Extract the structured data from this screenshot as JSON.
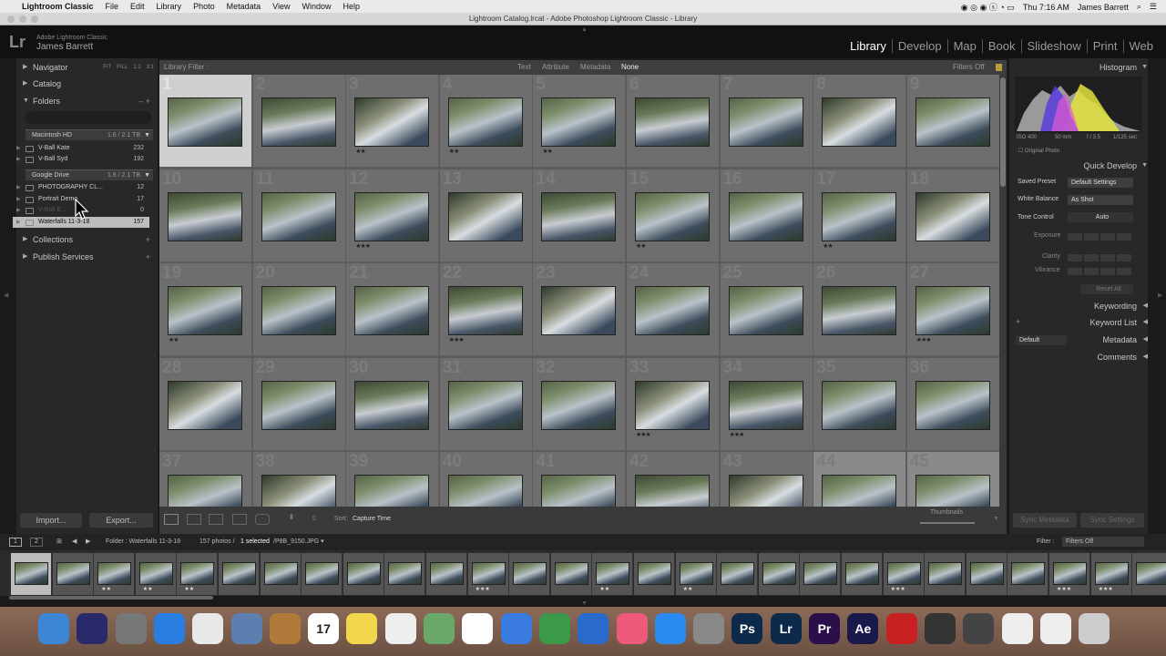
{
  "menubar": {
    "app": "Lightroom Classic",
    "items": [
      "File",
      "Edit",
      "Library",
      "Photo",
      "Metadata",
      "View",
      "Window",
      "Help"
    ],
    "clock": "Thu 7:16 AM",
    "user": "James Barrett"
  },
  "window": {
    "title": "Lightroom Catalog.lrcat - Adobe Photoshop Lightroom Classic - Library"
  },
  "identity": {
    "logo": "Lr",
    "product": "Adobe Lightroom Classic",
    "user": "James Barrett"
  },
  "modules": [
    "Library",
    "Develop",
    "Map",
    "Book",
    "Slideshow",
    "Print",
    "Web"
  ],
  "left": {
    "navigator": "Navigator",
    "nav_btns": [
      "FIT",
      "FILL",
      "1:1",
      "3:1"
    ],
    "catalog": "Catalog",
    "folders": "Folders",
    "vol1": {
      "name": "Macintosh HD",
      "info": "1.6 / 2.1 TB"
    },
    "vol1_folders": [
      {
        "name": "V-Ball Kate",
        "count": "232"
      },
      {
        "name": "V-Ball Syd",
        "count": "192"
      }
    ],
    "vol2": {
      "name": "Google Drive",
      "info": "1.6 / 2.1 TB"
    },
    "vol2_folders": [
      {
        "name": "PHOTOGRAPHY CL...",
        "count": "12"
      },
      {
        "name": "Portrait Demo",
        "count": "17"
      },
      {
        "name": "V-Ball B...",
        "count": "0"
      },
      {
        "name": "Waterfalls 11-3-18",
        "count": "157"
      }
    ],
    "collections": "Collections",
    "publish": "Publish Services",
    "import": "Import...",
    "export": "Export..."
  },
  "filter": {
    "label": "Library Filter :",
    "options": [
      "Text",
      "Attribute",
      "Metadata",
      "None"
    ],
    "status": "Filters Off"
  },
  "grid": {
    "rows": [
      {
        "nums": [
          "1",
          "2",
          "3",
          "4",
          "5",
          "6",
          "7",
          "8",
          "9"
        ],
        "stars": [
          "",
          "",
          "★★",
          "★★",
          "★★",
          "",
          "",
          "",
          ""
        ]
      },
      {
        "nums": [
          "10",
          "11",
          "12",
          "13",
          "14",
          "15",
          "16",
          "17",
          "18"
        ],
        "stars": [
          "",
          "",
          "★★★",
          "",
          "",
          "★★",
          "",
          "★★",
          ""
        ]
      },
      {
        "nums": [
          "19",
          "20",
          "21",
          "22",
          "23",
          "24",
          "25",
          "26",
          "27"
        ],
        "stars": [
          "★★",
          "",
          "",
          "★★★",
          "",
          "",
          "",
          "",
          "★★★"
        ]
      },
      {
        "nums": [
          "28",
          "29",
          "30",
          "31",
          "32",
          "33",
          "34",
          "35",
          "36"
        ],
        "stars": [
          "",
          "",
          "",
          "",
          "",
          "★★★",
          "★★★",
          "",
          ""
        ]
      },
      {
        "nums": [
          "37",
          "38",
          "39",
          "40",
          "41",
          "42",
          "43",
          "44",
          "45"
        ],
        "stars": [
          "",
          "",
          "",
          "",
          "",
          "",
          "",
          "",
          ""
        ]
      }
    ]
  },
  "toolbar": {
    "sort_label": "Sort:",
    "sort_value": "Capture Time",
    "thumbs": "Thumbnails"
  },
  "right": {
    "histogram": "Histogram",
    "iso": "ISO 400",
    "focal": "50 mm",
    "fstop": "f / 3.5",
    "shutter": "1/125 sec",
    "original": "Original Photo",
    "quick_develop": "Quick Develop",
    "saved_preset": "Saved Preset",
    "saved_preset_val": "Default Settings",
    "white_balance": "White Balance",
    "wb_val": "As Shot",
    "tone": "Tone Control",
    "auto": "Auto",
    "exposure": "Exposure",
    "clarity": "Clarity",
    "vibrance": "Vibrance",
    "reset": "Reset All",
    "keywording": "Keywording",
    "keyword_list": "Keyword List",
    "metadata": "Metadata",
    "metadata_preset": "Default",
    "comments": "Comments",
    "sync_metadata": "Sync Metadata",
    "sync_settings": "Sync Settings"
  },
  "filmbar": {
    "p1": "1",
    "p2": "2",
    "folder": "Folder : Waterfalls 11-3-18",
    "count": "157 photos /",
    "selected": "1 selected",
    "file": "/P8B_9150.JPG ▾",
    "filter_label": "Filter :",
    "filter_val": "Filters Off"
  },
  "film_stars": [
    "",
    "",
    "★★",
    "★★",
    "★★",
    "",
    "",
    "",
    "",
    "",
    "",
    "★★★",
    "",
    "",
    "★★",
    "",
    "★★",
    "",
    "",
    "",
    "",
    "★★★",
    "",
    "",
    "",
    "★★★",
    "★★★",
    "",
    ""
  ],
  "dock": [
    "Finder",
    "Siri",
    "Launchpad",
    "Safari",
    "Chrome",
    "Preview",
    "Notes",
    "17",
    "Stickies",
    "Reminders",
    "Maps",
    "Photos",
    "Keynote",
    "Numbers",
    "Keynote2",
    "Music",
    "App Store",
    "System Preferences",
    "Ps",
    "Lr",
    "Pr",
    "Ae",
    "Creative Cloud",
    "Sound",
    "QuickTime",
    "Documents",
    "Downloads",
    "Trash"
  ],
  "colors": {
    "accent": "#cfcfcf",
    "panel": "#282828",
    "grid": "#5b5b5b"
  }
}
